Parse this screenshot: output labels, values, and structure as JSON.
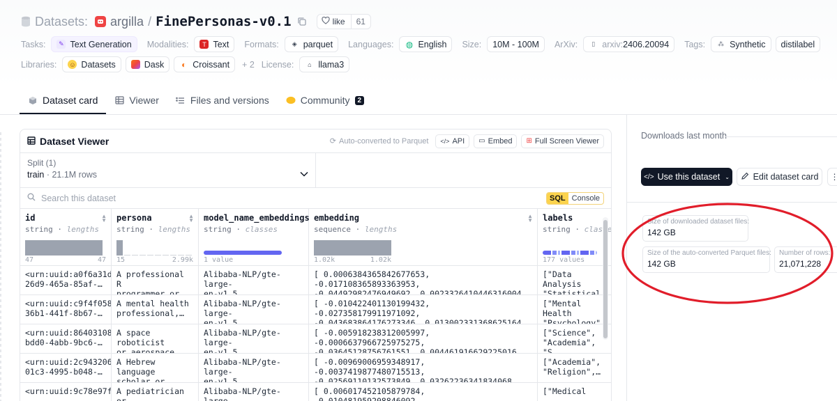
{
  "header": {
    "prefix": "Datasets:",
    "org": "argilla",
    "separator": "/",
    "repo": "FinePersonas-v0.1",
    "like_label": "like",
    "like_count": "61"
  },
  "meta": {
    "tasks_key": "Tasks:",
    "tasks": [
      "Text Generation"
    ],
    "modalities_key": "Modalities:",
    "modalities": [
      "Text"
    ],
    "formats_key": "Formats:",
    "formats": [
      "parquet"
    ],
    "languages_key": "Languages:",
    "languages": [
      "English"
    ],
    "size_key": "Size:",
    "size": "10M - 100M",
    "arxiv_key": "ArXiv:",
    "arxiv_prefix": "arxiv:",
    "arxiv_id": "2406.20094",
    "tags_key": "Tags:",
    "tags": [
      "Synthetic",
      "distilabel"
    ],
    "libraries_key": "Libraries:",
    "libraries": [
      "Datasets",
      "Dask",
      "Croissant"
    ],
    "libraries_more": "+ 2",
    "license_key": "License:",
    "license": "llama3"
  },
  "tabs": [
    {
      "label": "Dataset card",
      "active": true
    },
    {
      "label": "Viewer"
    },
    {
      "label": "Files and versions"
    },
    {
      "label": "Community",
      "badge": "2"
    }
  ],
  "viewer": {
    "title": "Dataset Viewer",
    "auto_converted": "Auto-converted to Parquet",
    "api_label": "API",
    "embed_label": "Embed",
    "fullscreen_label": "Full Screen Viewer",
    "split_label": "Split (1)",
    "split_name": "train",
    "split_rows": "· 21.1M rows",
    "search_placeholder": "Search this dataset",
    "sql_label": "SQL",
    "console_label": "Console",
    "columns": [
      {
        "name": "id",
        "type": "string",
        "stat": "lengths",
        "min": "47",
        "max": "47"
      },
      {
        "name": "persona",
        "type": "string",
        "stat": "lengths",
        "min": "15",
        "max": "2.99k"
      },
      {
        "name": "model_name_embeddings",
        "type": "string",
        "stat": "classes",
        "summary": "1 value"
      },
      {
        "name": "embedding",
        "type": "sequence",
        "stat": "lengths",
        "min": "1.02k",
        "max": "1.02k"
      },
      {
        "name": "labels",
        "type": "string",
        "stat": "classes",
        "summary": "177 values"
      }
    ],
    "rows": [
      [
        "<urn:uuid:a0f6a31d-\n26d9-465a-85af-…",
        "A professional R\nprogrammer or…",
        "Alibaba-NLP/gte-large-\nen-v1.5",
        "[ 0.0006384365842677653, -0.017108365893363953,\n-0.04492982476949692, 0.0023326410446316004,…",
        "[\"Data Analysis\n\"Statistical…"
      ],
      [
        "<urn:uuid:c9f4f058-\n36b1-441f-8b67-…",
        "A mental health\nprofessional,…",
        "Alibaba-NLP/gte-large-\nen-v1.5",
        "[ -0.010422401130199432, -0.027358179911971092,\n-0.043683864176273346, 0.013002331368625164,…",
        "[\"Mental Health\n\"Psychology\",…"
      ],
      [
        "<urn:uuid:86403108-\nbdd0-4abb-9bc6-…",
        "A space roboticist\nor aerospace…",
        "Alibaba-NLP/gte-large-\nen-v1.5",
        "[ -0.005918238312005997, -0.0006637966725975275,\n-0.03645128756761551, 0.004461916629225016,…",
        "[\"Science\",\n\"Academia\", \"S"
      ],
      [
        "<urn:uuid:2c943206-\n01c3-4995-b048-…",
        "A Hebrew language\nscholar or…",
        "Alibaba-NLP/gte-large-\nen-v1.5",
        "[ -0.00969006959348917, -0.0037419877480715513,\n-0.02569110132573849, 0.03262236341834068,…",
        "[\"Academia\",\n\"Religion\",…"
      ],
      [
        "<urn:uuid:9c78e97f-\n…",
        "A pediatrician or\n…",
        "Alibaba-NLP/gte-large-\n…",
        "[ 0.006017452105879784, -0.010481959208846092,\n…",
        "[\"Medical\n…"
      ]
    ]
  },
  "sidebar": {
    "downloads_label": "Downloads last month",
    "use_button": "Use this dataset",
    "edit_button": "Edit dataset card",
    "stats": {
      "download_size_label": "Size of downloaded dataset files:",
      "download_size": "142 GB",
      "parquet_size_label": "Size of the auto-converted Parquet files:",
      "parquet_size": "142 GB",
      "rows_label": "Number of rows:",
      "rows": "21,071,228"
    }
  },
  "colors": {
    "accent_dark": "#111827",
    "annotation_red": "#e11d2a",
    "class_bar": "#6366f1",
    "histogram": "#9ca3af"
  }
}
